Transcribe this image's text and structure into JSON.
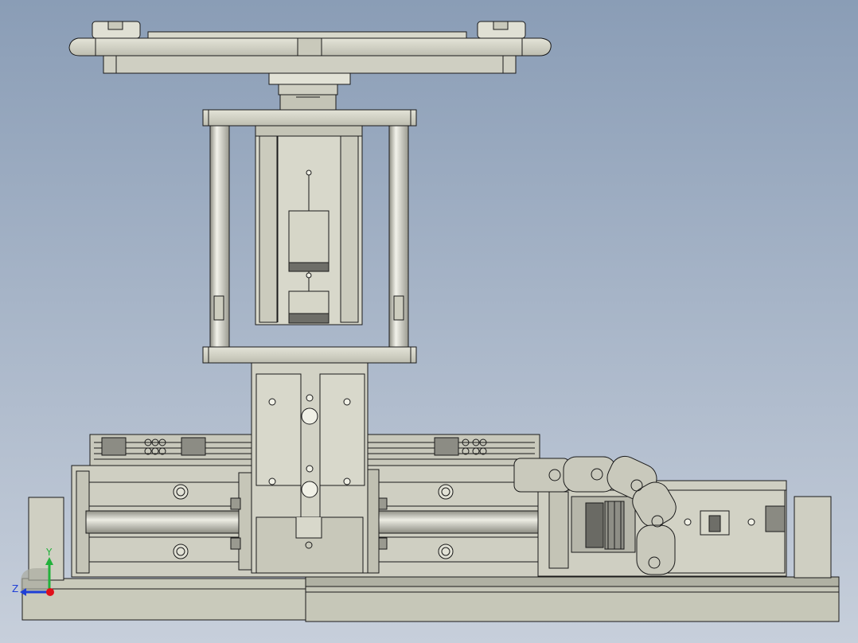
{
  "viewport": {
    "name": "cad-3d-viewport",
    "background_top": "#8A9DB6",
    "background_bottom": "#C7CFDB"
  },
  "model": {
    "part_fill": "#D4D4C6",
    "part_shade": "#B7B8A9",
    "dark_fill": "#6E6E68",
    "edge_color": "#1A1A1A"
  },
  "triad": {
    "x_label": "",
    "y_label": "Y",
    "z_label": "Z",
    "y_color": "#22B13B",
    "z_color": "#1F3FD6",
    "origin_color": "#E0101A"
  }
}
